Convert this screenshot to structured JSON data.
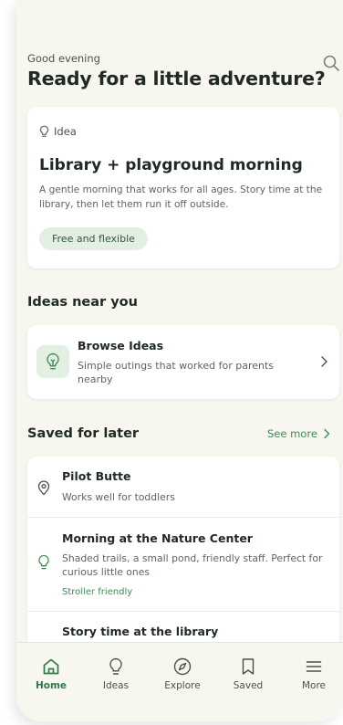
{
  "header": {
    "greeting": "Good evening",
    "headline": "Ready for a little adventure?"
  },
  "idea_card": {
    "tag": "Idea",
    "title": "Library + playground morning",
    "description": "A gentle morning that works for all ages. Story time at the library, then let them run it off outside.",
    "chip": "Free and flexible"
  },
  "nearby": {
    "section_title": "Ideas near you",
    "browse_title": "Browse Ideas",
    "browse_subtitle": "Simple outings that worked for parents nearby"
  },
  "saved": {
    "section_title": "Saved for later",
    "see_more": "See more",
    "items": [
      {
        "title": "Pilot Butte",
        "subtitle": "Works well for toddlers",
        "icon": "location-pin-icon"
      },
      {
        "title": "Morning at the Nature Center",
        "subtitle": "Shaded trails, a small pond, friendly staff. Perfect for curious little ones",
        "badge": "Stroller friendly",
        "icon": "lightbulb-icon"
      },
      {
        "title": "Story time at the library",
        "icon": "book-icon"
      }
    ]
  },
  "tabs": [
    {
      "label": "Home",
      "icon": "home-icon",
      "active": true
    },
    {
      "label": "Ideas",
      "icon": "lightbulb-icon",
      "active": false
    },
    {
      "label": "Explore",
      "icon": "compass-icon",
      "active": false
    },
    {
      "label": "Saved",
      "icon": "bookmark-icon",
      "active": false
    },
    {
      "label": "More",
      "icon": "menu-icon",
      "active": false
    }
  ],
  "colors": {
    "background": "#f7f6ef",
    "accent": "#3f8a55",
    "chip_bg": "#e4efe4",
    "text": "#1f2a24"
  }
}
